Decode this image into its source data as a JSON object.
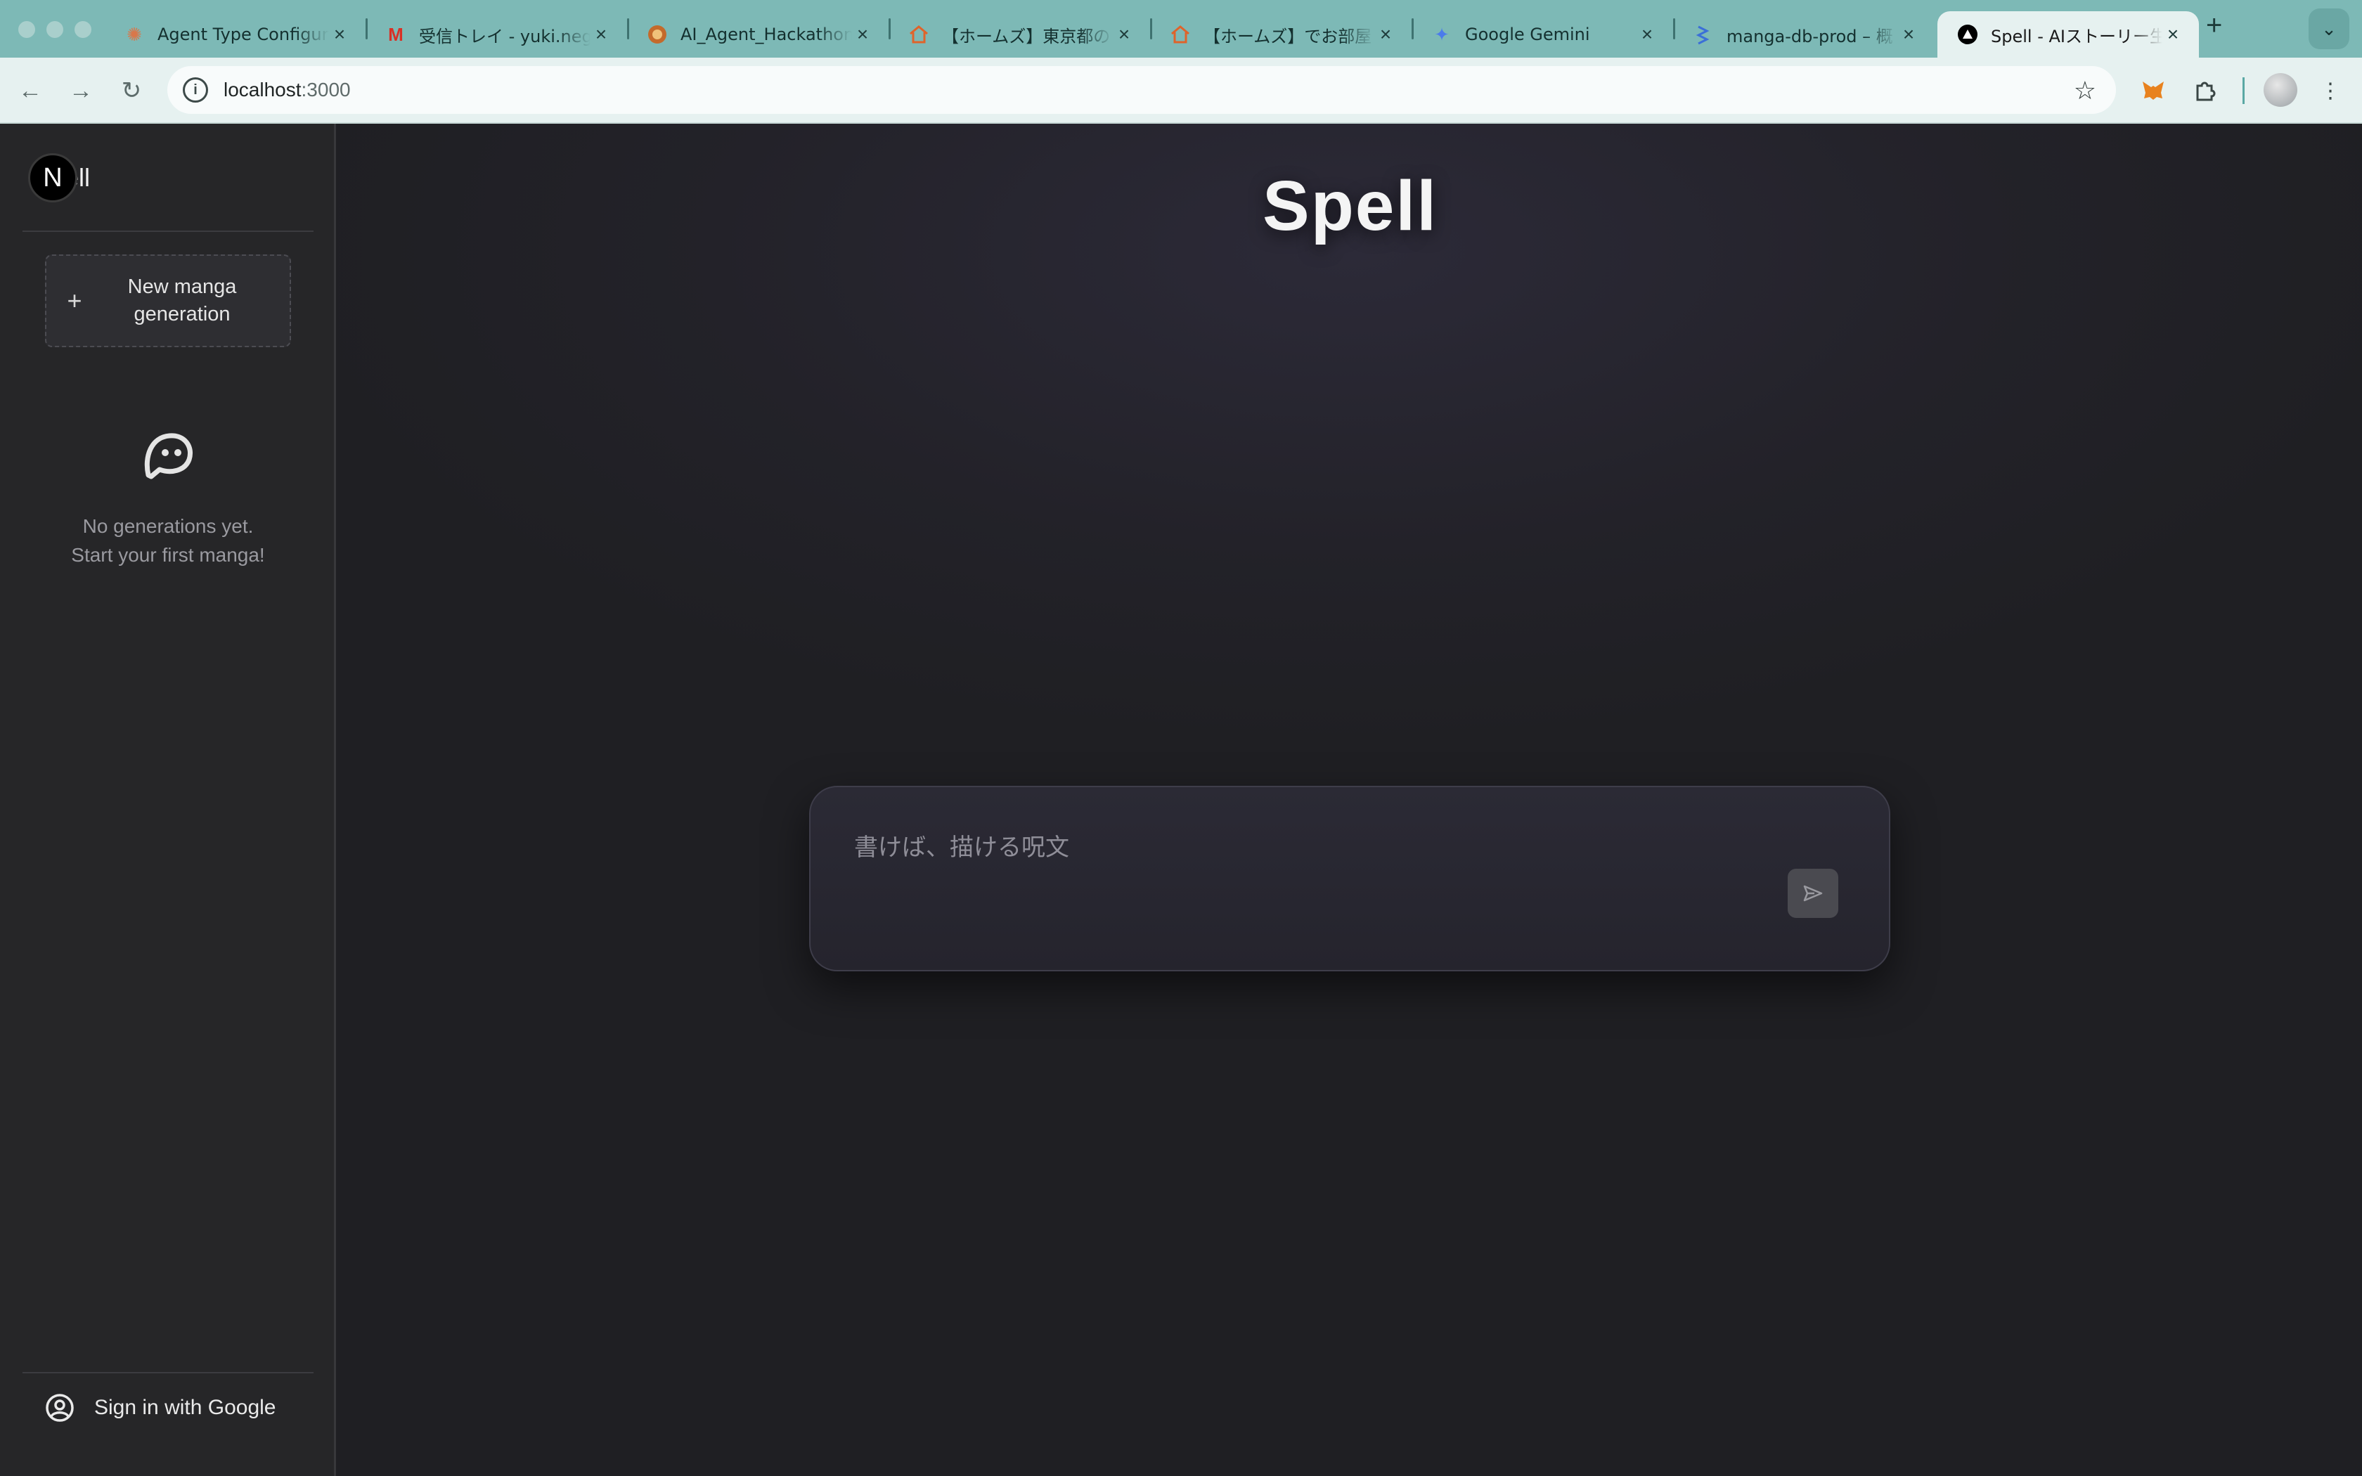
{
  "browser": {
    "tabs": [
      {
        "title": "Agent Type Configur",
        "favicon": "sunburst-icon",
        "color": "#d9774a"
      },
      {
        "title": "受信トレイ - yuki.neg",
        "favicon": "gmail-icon",
        "color": "#d93025"
      },
      {
        "title": "AI_Agent_Hackathon",
        "favicon": "hackathon-icon",
        "color": "#c46a2b"
      },
      {
        "title": "【ホームズ】東京都の",
        "favicon": "homes-icon",
        "color": "#e0632a"
      },
      {
        "title": "【ホームズ】でお部屋",
        "favicon": "homes-icon",
        "color": "#e0632a"
      },
      {
        "title": "Google Gemini",
        "favicon": "gemini-icon",
        "color": "#4b7bec"
      },
      {
        "title": "manga-db-prod – 概",
        "favicon": "database-icon",
        "color": "#3b6fd8"
      },
      {
        "title": "Spell - AIストーリー生",
        "favicon": "triangle-icon",
        "color": "#000000",
        "active": true
      }
    ],
    "url_host": "localhost",
    "url_port": ":3000"
  },
  "sidebar": {
    "brand_initial": "N",
    "brand_name": "ell",
    "new_button_label": "New manga generation",
    "empty_line1": "No generations yet.",
    "empty_line2": "Start your first manga!",
    "signin_label": "Sign in with Google"
  },
  "main": {
    "title": "Spell",
    "prompt_placeholder": "書けば、描ける呪文",
    "prompt_value": ""
  }
}
